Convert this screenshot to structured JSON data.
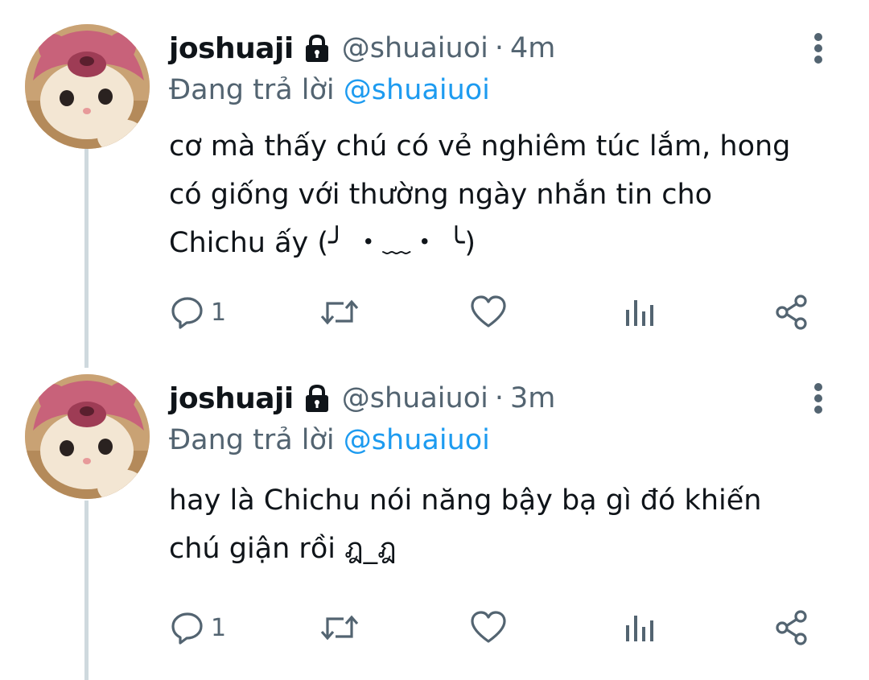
{
  "tweets": [
    {
      "display_name": "joshuaji",
      "handle": "@shuaiuoi",
      "separator": "·",
      "time": "4m",
      "reply_prefix": "Đang trả lời",
      "reply_to": "@shuaiuoi",
      "text": "cơ mà thấy chú có vẻ nghiêm túc lắm, hong\ncó giống với thường ngày nhắn tin cho\nChichu ấy (╯ ・﹏・ ╰)",
      "reply_count": "1",
      "icons": [
        "lock-icon",
        "more-icon",
        "reply-icon",
        "retweet-icon",
        "like-icon",
        "analytics-icon",
        "share-icon"
      ]
    },
    {
      "display_name": "joshuaji",
      "handle": "@shuaiuoi",
      "separator": "·",
      "time": "3m",
      "reply_prefix": "Đang trả lời",
      "reply_to": "@shuaiuoi",
      "text": "hay là Chichu nói năng bậy bạ gì đó khiến\nchú giận rồi ฎ_ฎ",
      "reply_count": "1",
      "icons": [
        "lock-icon",
        "more-icon",
        "reply-icon",
        "retweet-icon",
        "like-icon",
        "analytics-icon",
        "share-icon"
      ]
    }
  ],
  "colors": {
    "text": "#0f1419",
    "secondary": "#536471",
    "mention": "#1d9bf0",
    "thread_line": "#cfd9de"
  }
}
